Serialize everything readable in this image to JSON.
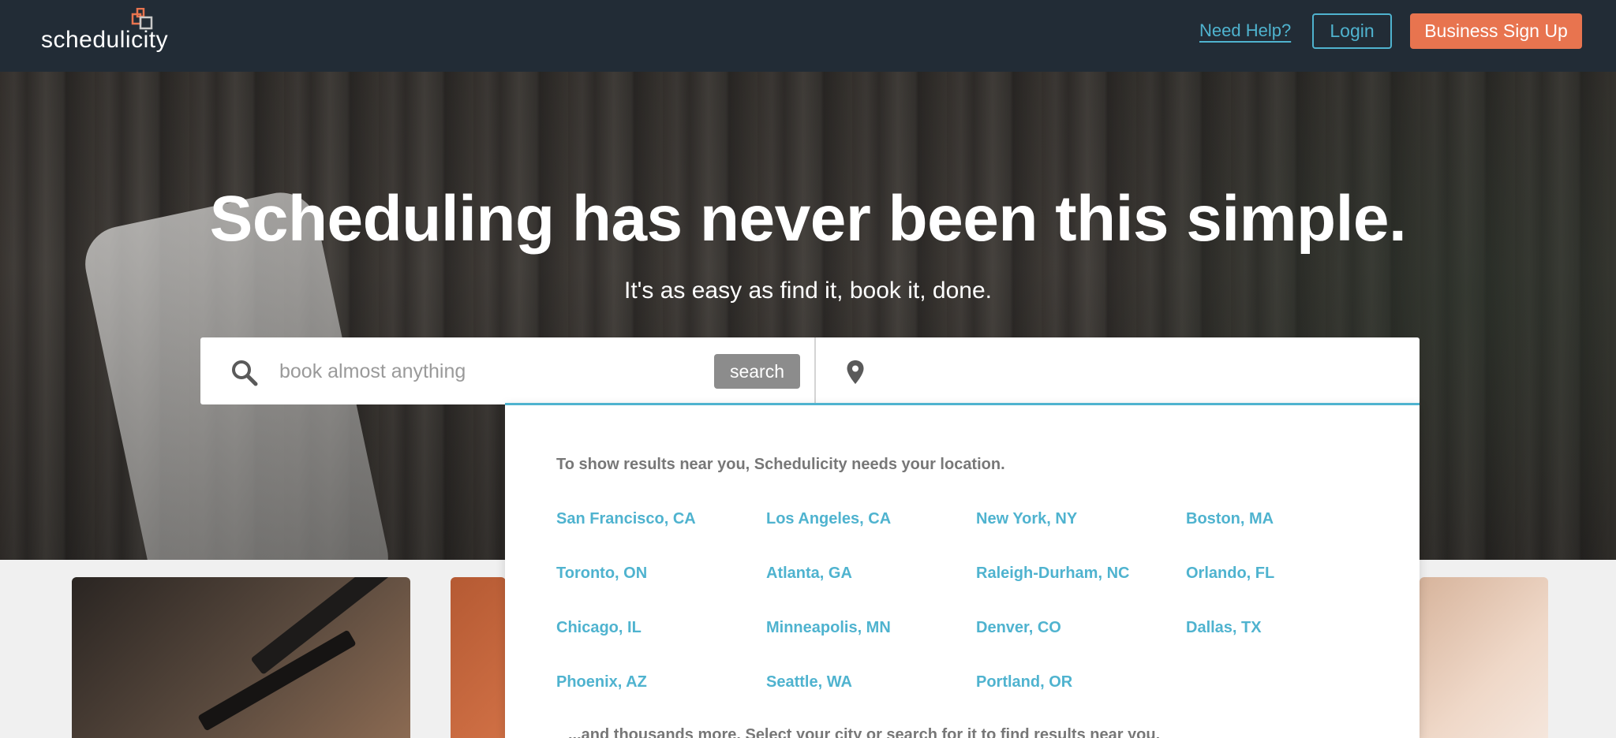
{
  "header": {
    "logo_text": "schedulicity",
    "need_help": "Need Help?",
    "login": "Login",
    "business_signup": "Business Sign Up"
  },
  "hero": {
    "title": "Scheduling has never been this simple.",
    "subtitle": "It's as easy as find it, book it, done."
  },
  "search": {
    "placeholder": "book almost anything",
    "value": "",
    "button_label": "search",
    "location_value": ""
  },
  "location_dropdown": {
    "message": "To show results near you, Schedulicity needs your location.",
    "cities": [
      "San Francisco, CA",
      "Los Angeles, CA",
      "New York, NY",
      "Boston, MA",
      "Toronto, ON",
      "Atlanta, GA",
      "Raleigh-Durham, NC",
      "Orlando, FL",
      "Chicago, IL",
      "Minneapolis, MN",
      "Denver, CO",
      "Dallas, TX",
      "Phoenix, AZ",
      "Seattle, WA",
      "Portland, OR"
    ],
    "more_text": "...and thousands more. Select your city or search for it to find results near you."
  },
  "colors": {
    "nav_bg": "#222c36",
    "accent_blue": "#4fb3cf",
    "accent_orange": "#e8744f",
    "search_button": "#8c8c8c"
  },
  "icons": [
    "logo-mark-icon",
    "search-icon",
    "location-pin-icon"
  ]
}
